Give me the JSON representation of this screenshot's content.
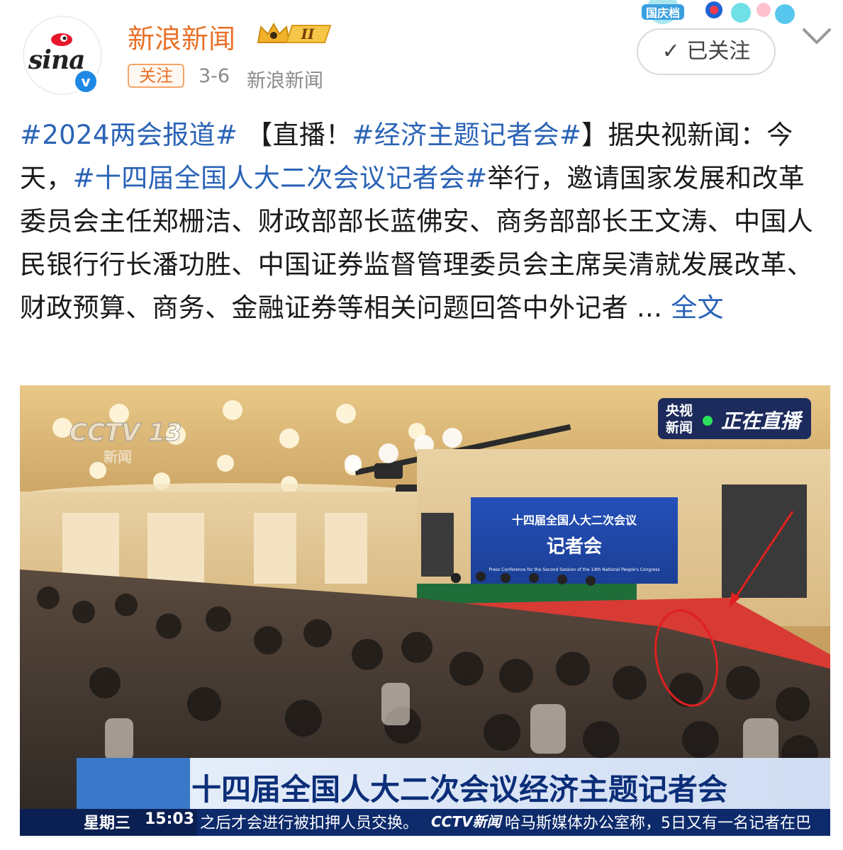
{
  "account": {
    "name": "新浪新闻",
    "avatar_text": "sina",
    "verified_badge": "v",
    "level_badge": "II",
    "follow_tag": "关注",
    "date": "3-6",
    "source": "新浪新闻",
    "followed_label": "已关注",
    "holiday_badge": "国庆档"
  },
  "post": {
    "tag1": "#2024两会报道#",
    "text1": " 【直播！",
    "tag2": "#经济主题记者会#",
    "text2": "】据央视新闻：今天，",
    "tag3": "#十四届全国人大二次会议记者会#",
    "text3": "举行，邀请国家发展和改革委员会主任郑栅洁、财政部部长蓝佛安、商务部部长王文涛、中国人民银行行长潘功胜、中国证券监督管理委员会主席吴清就发展改革、财政预算、商务、金融证券等相关问题回答中外记者 ... ",
    "more": "全文"
  },
  "video": {
    "channel_logo": "CCTV 13",
    "channel_sub": "新闻",
    "live_badge_line1": "央视",
    "live_badge_line2": "新闻",
    "live_badge_text": "正在直播",
    "backdrop_line1": "十四届全国人大二次会议",
    "backdrop_line2": "记者会",
    "backdrop_en": "Press Conference for the Second Session of the 14th National People's Congress",
    "headline": "十四届全国人大二次会议经济主题记者会",
    "weekday": "星期三",
    "time": "15:03",
    "ticker_left": "之后才会进行被扣押人员交换。",
    "ticker_logo": "CCTV新闻",
    "ticker_right": "哈马斯媒体办公室称，5日又有一名记者在巴"
  },
  "colors": {
    "brand_orange": "#e8722a",
    "link_blue": "#2a63b6",
    "verified_blue": "#1e88e5",
    "annotation_red": "#e02020"
  }
}
